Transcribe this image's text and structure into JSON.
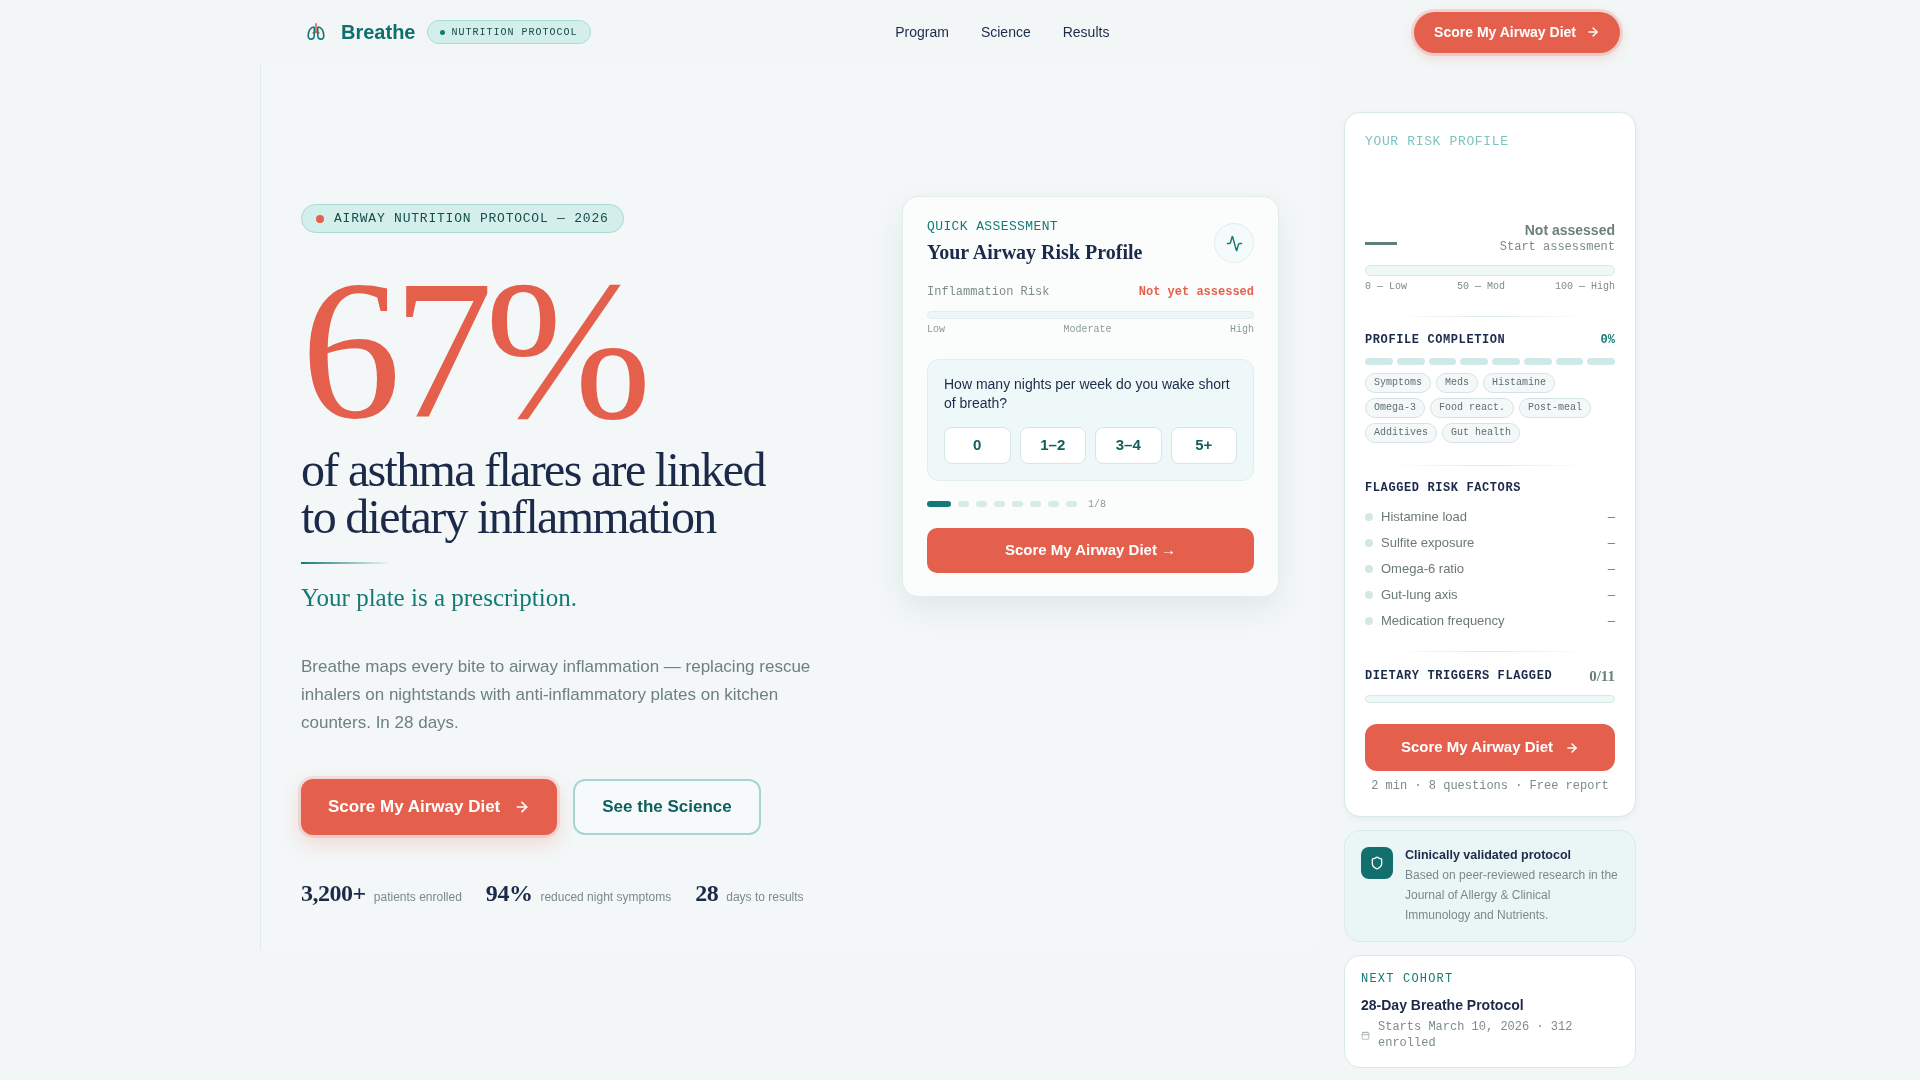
{
  "header": {
    "brand": "Breathe",
    "badge": "NUTRITION PROTOCOL",
    "nav": [
      {
        "label": "Program"
      },
      {
        "label": "Science"
      },
      {
        "label": "Results"
      }
    ],
    "cta": "Score My Airway Diet"
  },
  "hero": {
    "eyebrow": "AIRWAY NUTRITION PROTOCOL — 2026",
    "stat": "67%",
    "headline": "of asthma flares are linked to dietary inflammation",
    "tagline": "Your plate is a prescription.",
    "body": "Breathe maps every bite to airway inflammation — replacing rescue inhalers on nightstands with anti-inflammatory plates on kitchen counters. In 28 days.",
    "buttons": [
      {
        "kind": "primary",
        "label": "Score My Airway Diet"
      },
      {
        "kind": "secondary",
        "label": "See the Science"
      }
    ],
    "stats": [
      {
        "value": "3,200+",
        "label": "patients enrolled"
      },
      {
        "value": "94%",
        "label": "reduced night symptoms"
      },
      {
        "value": "28",
        "label": "days to results"
      }
    ]
  },
  "assessment": {
    "eyebrow": "QUICK ASSESSMENT",
    "title": "Your Airway Risk Profile",
    "risk_label": "Inflammation Risk",
    "risk_status": "Not yet assessed",
    "scale": [
      "Low",
      "Moderate",
      "High"
    ],
    "question": "How many nights per week do you wake short of breath?",
    "options": [
      {
        "label": "0",
        "selected": false
      },
      {
        "label": "1–2",
        "selected": false
      },
      {
        "label": "3–4",
        "selected": false
      },
      {
        "label": "5+",
        "selected": false
      }
    ],
    "steps": [
      {
        "active": true
      },
      {
        "active": false
      },
      {
        "active": false
      },
      {
        "active": false
      },
      {
        "active": false
      },
      {
        "active": false
      },
      {
        "active": false
      },
      {
        "active": false
      }
    ],
    "step_counter": "1/8",
    "cta": "Score My Airway Diet →"
  },
  "risk_profile": {
    "title": "YOUR RISK PROFILE",
    "score_status": "Not assessed",
    "score_hint": "Start assessment",
    "scale": [
      "0 — Low",
      "50 — Mod",
      "100 — High"
    ],
    "completion": {
      "title": "PROFILE COMPLETION",
      "value": "0%",
      "segments": [
        {
          "filled": false
        },
        {
          "filled": false
        },
        {
          "filled": false
        },
        {
          "filled": false
        },
        {
          "filled": false
        },
        {
          "filled": false
        },
        {
          "filled": false
        },
        {
          "filled": false
        }
      ],
      "chips": [
        "Symptoms",
        "Meds",
        "Histamine",
        "Omega-3",
        "Food react.",
        "Post-meal",
        "Additives",
        "Gut health"
      ]
    },
    "factors": {
      "title": "FLAGGED RISK FACTORS",
      "items": [
        {
          "label": "Histamine load",
          "value": "–"
        },
        {
          "label": "Sulfite exposure",
          "value": "–"
        },
        {
          "label": "Omega-6 ratio",
          "value": "–"
        },
        {
          "label": "Gut-lung axis",
          "value": "–"
        },
        {
          "label": "Medication frequency",
          "value": "–"
        }
      ]
    },
    "triggers": {
      "title": "DIETARY TRIGGERS FLAGGED",
      "count": "0/11"
    },
    "cta": "Score My Airway Diet",
    "footnote": "2 min · 8 questions · Free report"
  },
  "validation": {
    "title": "Clinically validated protocol",
    "text": "Based on peer-reviewed research in the Journal of Allergy & Clinical Immunology and Nutrients."
  },
  "cohort": {
    "eyebrow": "NEXT COHORT",
    "title": "28-Day Breathe Protocol",
    "detail": "Starts March 10, 2026 · 312 enrolled"
  }
}
